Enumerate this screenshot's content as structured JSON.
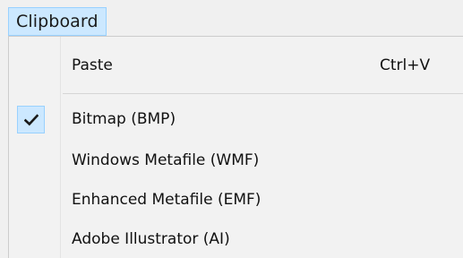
{
  "menubar": {
    "title": "Clipboard"
  },
  "menu": {
    "paste": {
      "label": "Paste",
      "shortcut": "Ctrl+V"
    },
    "formats": [
      {
        "label": "Bitmap (BMP)",
        "checked": true,
        "icon": "checkmark-icon"
      },
      {
        "label": "Windows Metafile (WMF)",
        "checked": false
      },
      {
        "label": "Enhanced Metafile (EMF)",
        "checked": false
      },
      {
        "label": "Adobe Illustrator (AI)",
        "checked": false
      }
    ]
  },
  "colors": {
    "highlight_fill": "#cce8ff",
    "highlight_border": "#99d1ff",
    "menu_background": "#f2f2f2"
  }
}
